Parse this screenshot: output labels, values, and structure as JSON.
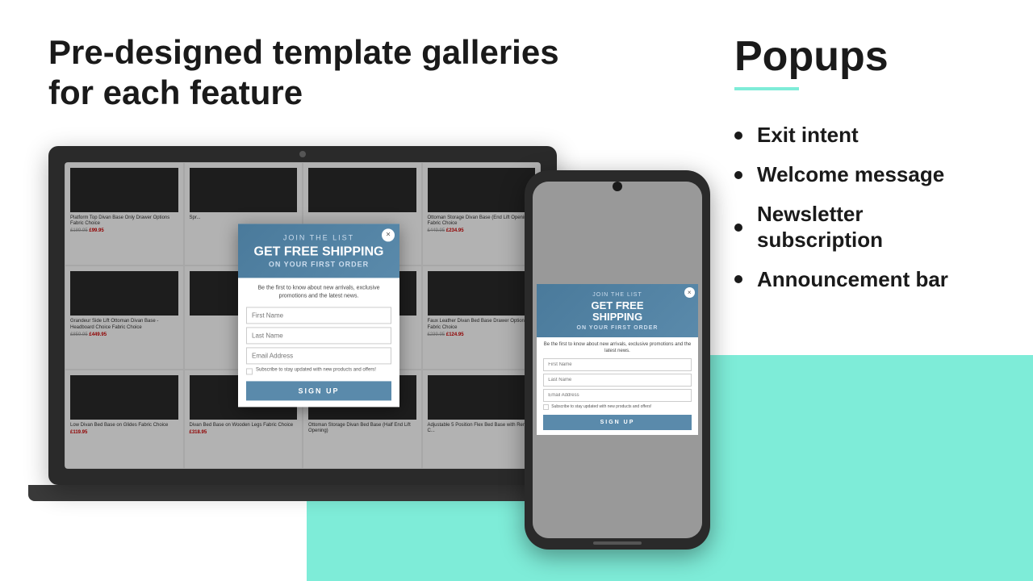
{
  "page": {
    "title": "Pre-designed template galleries for each feature",
    "teal_accent": "#7EECD8"
  },
  "left": {
    "title_line1": "Pre-designed template galleries",
    "title_line2": "for each feature"
  },
  "right": {
    "section_title": "Popups",
    "bullets": [
      {
        "id": 1,
        "text": "Exit intent"
      },
      {
        "id": 2,
        "text": "Welcome message"
      },
      {
        "id": 3,
        "text": "Newsletter subscription"
      },
      {
        "id": 4,
        "text": "Announcement bar"
      }
    ]
  },
  "popup": {
    "join_text": "JOIN THE LIST",
    "headline": "GET FREE SHIPPING",
    "subheadline": "ON YOUR FIRST ORDER",
    "description": "Be the first to know about new arrivals, exclusive promotions and the latest news.",
    "first_name_placeholder": "First Name",
    "last_name_placeholder": "Last Name",
    "email_placeholder": "Email Address",
    "checkbox_text": "Subscribe to stay updated with new products and offers!",
    "button_text": "SIGN UP",
    "close_symbol": "×"
  },
  "products": [
    {
      "name": "Platform Top Divan Base Only Drawer Options Fabric Choice",
      "original": "£189.95",
      "sale": "£99.95"
    },
    {
      "name": "Spr...",
      "original": "",
      "sale": ""
    },
    {
      "name": "",
      "original": "",
      "sale": ""
    },
    {
      "name": "Ottoman Storage Divan Base (End Lift Opening) Fabric Choice",
      "original": "£449.95",
      "sale": "£234.95"
    },
    {
      "name": "Grandeur Side Lift Ottoman Divan Base - Headboard Choice Fabric Choice",
      "original": "£859.95",
      "sale": "£449.95"
    },
    {
      "name": "",
      "original": "",
      "sale": ""
    },
    {
      "name": "",
      "original": "",
      "sale": ""
    },
    {
      "name": "Faux Leather Divan Bed Base Drawer Options Fabric Choice",
      "original": "£239.95",
      "sale": "£124.95"
    },
    {
      "name": "Low Divan Bed Base on Glides Fabric Choice",
      "original": "",
      "sale": "£119.95"
    },
    {
      "name": "Divan Bed Base on Wooden Legs Fabric Choice",
      "original": "",
      "sale": "£318.95"
    },
    {
      "name": "Ottoman Storage Divan Bed Base (Half End Lift Opening) Fabric Choice",
      "original": "",
      "sale": ""
    },
    {
      "name": "Adjustable 5 Position Flex Bed Base with Remote C...",
      "original": "",
      "sale": ""
    }
  ]
}
